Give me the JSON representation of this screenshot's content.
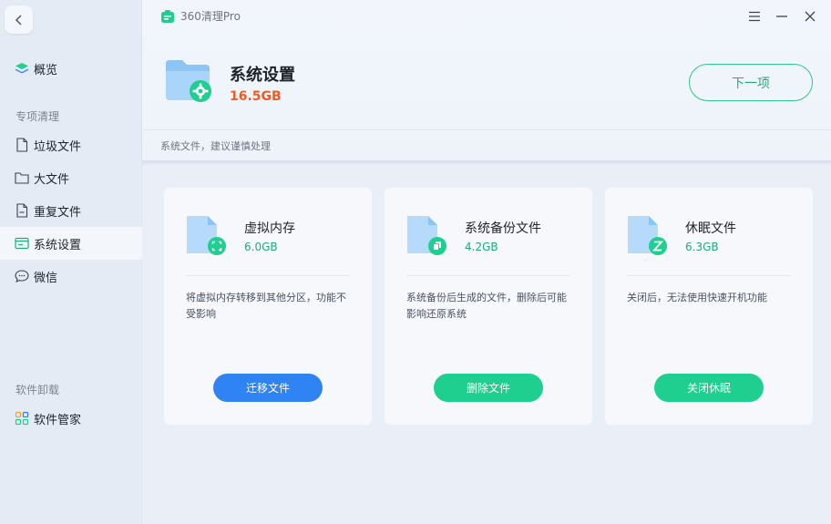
{
  "window": {
    "app_name": "360清理Pro"
  },
  "sidebar": {
    "overview": "概览",
    "group_special": "专项清理",
    "items": [
      {
        "label": "垃圾文件"
      },
      {
        "label": "大文件"
      },
      {
        "label": "重复文件"
      },
      {
        "label": "系统设置"
      },
      {
        "label": "微信"
      }
    ],
    "group_uninstall": "软件卸载",
    "software_manager": "软件管家"
  },
  "header": {
    "title": "系统设置",
    "size": "16.5GB",
    "next_label": "下一项",
    "description": "系统文件，建议谨慎处理"
  },
  "cards": [
    {
      "title": "虚拟内存",
      "size": "6.0GB",
      "description": "将虚拟内存转移到其他分区，功能不受影响",
      "button": "迁移文件"
    },
    {
      "title": "系统备份文件",
      "size": "4.2GB",
      "description": "系统备份后生成的文件，删除后可能影响还原系统",
      "button": "删除文件"
    },
    {
      "title": "休眠文件",
      "size": "6.3GB",
      "description": "关闭后，无法使用快速开机功能",
      "button": "关闭休眠"
    }
  ],
  "colors": {
    "accent_green": "#1fcf8f",
    "accent_blue": "#2f83f3",
    "size_orange": "#f05a23"
  }
}
